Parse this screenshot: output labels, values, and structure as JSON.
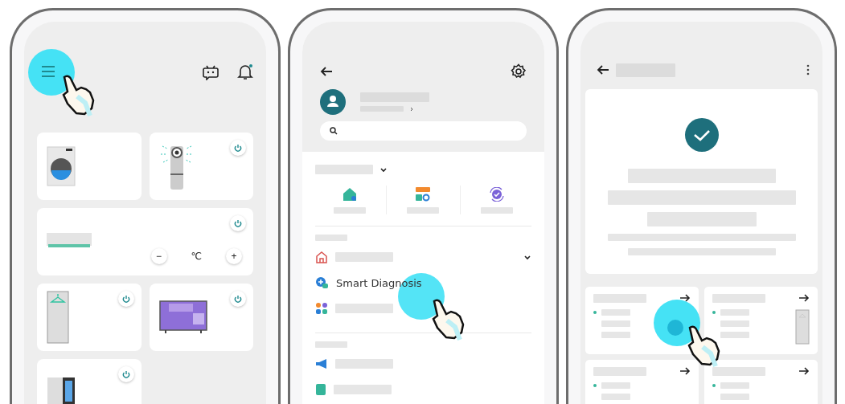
{
  "home": {
    "temperature_unit": "℃",
    "decrease_label": "−",
    "increase_label": "+"
  },
  "menu": {
    "item_label": "Smart Diagnosis"
  }
}
